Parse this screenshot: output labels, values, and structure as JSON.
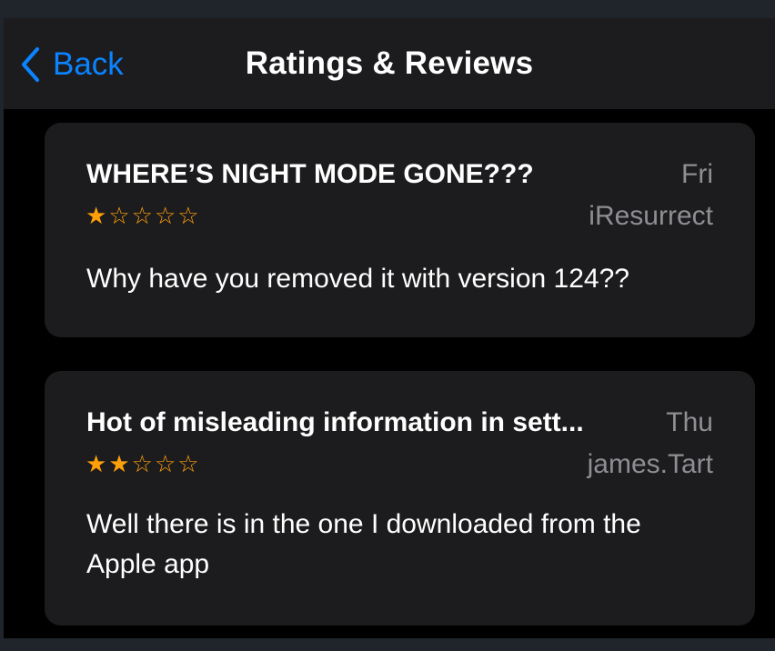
{
  "nav": {
    "back_label": "Back",
    "title": "Ratings & Reviews"
  },
  "reviews": [
    {
      "title": "WHERE’S NIGHT MODE GONE???",
      "date": "Fri",
      "author": "iResurrect",
      "rating": 1,
      "max_rating": 5,
      "body": "Why have you removed it with version 124??"
    },
    {
      "title": "Hot of misleading information in sett...",
      "date": "Thu",
      "author": "james.Tart",
      "rating": 2,
      "max_rating": 5,
      "body": "Well there is in the one I downloaded from the Apple app"
    }
  ],
  "colors": {
    "accent": "#0a84ff",
    "star": "#ff9f0a",
    "card_bg": "#1c1c1e",
    "secondary_text": "#8e8e93"
  }
}
